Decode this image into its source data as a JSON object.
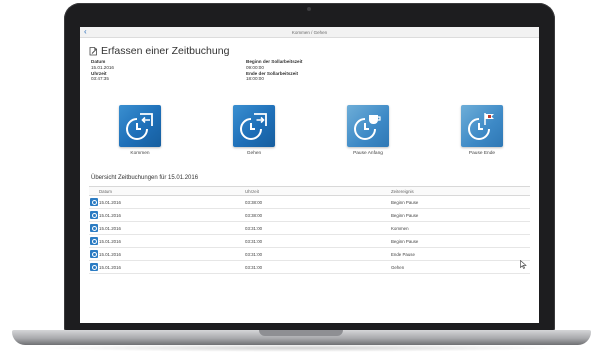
{
  "window": {
    "back_label": "‹",
    "title": "Kommen / Gehen"
  },
  "form": {
    "title": "Erfassen einer Zeitbuchung",
    "fields_left": [
      {
        "label": "Datum",
        "value": "15.01.2016"
      },
      {
        "label": "Uhrzeit",
        "value": "03:47:35"
      }
    ],
    "fields_right": [
      {
        "label": "Beginn der Sollarbeitszeit",
        "value": "09:00:00"
      },
      {
        "label": "Ende der Sollarbeitszeit",
        "value": "18:00:00"
      }
    ]
  },
  "tiles": [
    {
      "label": "Kommen",
      "icon": "clock-arrow-in-icon"
    },
    {
      "label": "Gehen",
      "icon": "clock-arrow-out-icon"
    },
    {
      "label": "Pause Anfang",
      "icon": "clock-coffee-icon"
    },
    {
      "label": "Pause Ende",
      "icon": "clock-flag-icon"
    }
  ],
  "overview": {
    "title": "Übersicht Zeitbuchungen für 15.01.2016",
    "columns": [
      "Datum",
      "Uhrzeit",
      "Zeitereignis"
    ],
    "rows": [
      {
        "date": "15.01.2016",
        "time": "03:38:00",
        "event": "Beginn Pause"
      },
      {
        "date": "15.01.2016",
        "time": "03:38:00",
        "event": "Beginn Pause"
      },
      {
        "date": "15.01.2016",
        "time": "03:31:00",
        "event": "Kommen"
      },
      {
        "date": "15.01.2016",
        "time": "03:31:00",
        "event": "Beginn Pause"
      },
      {
        "date": "15.01.2016",
        "time": "03:31:00",
        "event": "Ende Pause"
      },
      {
        "date": "15.01.2016",
        "time": "03:31:00",
        "event": "Gehen"
      }
    ]
  },
  "colors": {
    "tile_blue": "#1e6fb8",
    "tile_blue_soft": "#3d89c6",
    "laptop_bezel": "#1d1d1f"
  }
}
